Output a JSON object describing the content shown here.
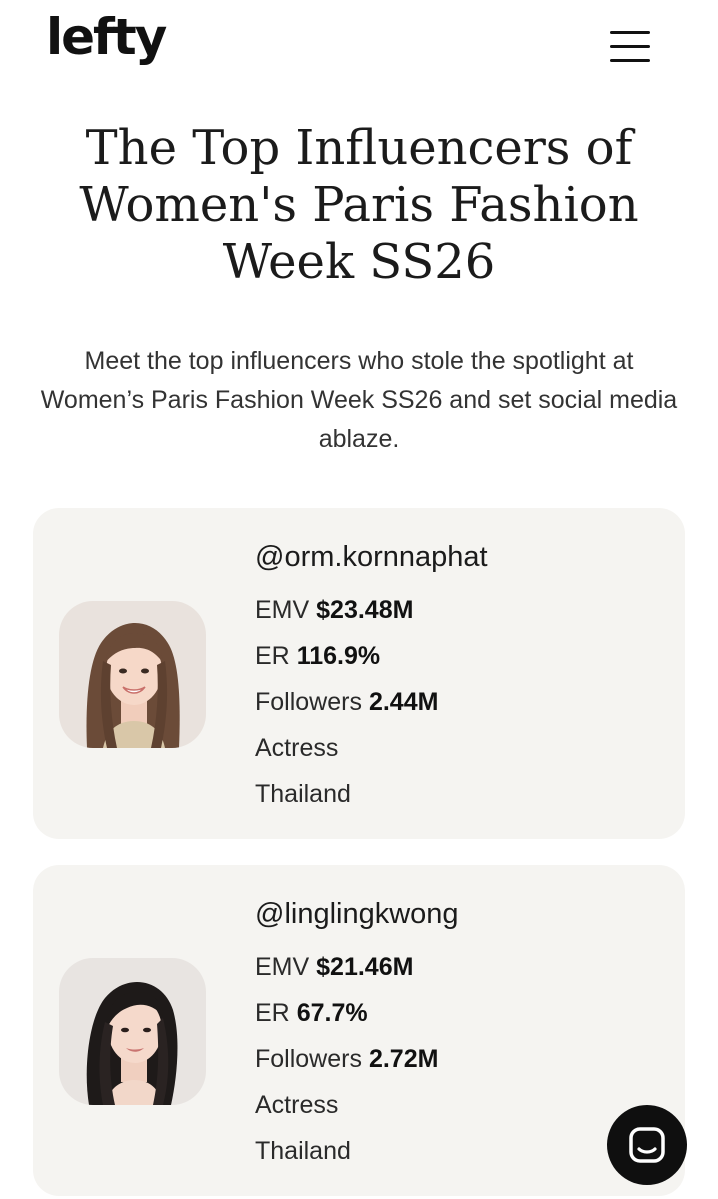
{
  "header": {
    "logo_text": "lefty",
    "menu_icon": "hamburger-menu-icon"
  },
  "hero": {
    "title": "The Top Influencers of Women's Paris Fashion Week SS26",
    "subtitle": "Meet the top influencers who stole the spotlight at Women’s Paris Fashion Week SS26 and set social media ablaze."
  },
  "influencers": [
    {
      "handle": "@orm.kornnaphat",
      "emv_label": "EMV",
      "emv_value": "$23.48M",
      "er_label": "ER",
      "er_value": "116.9%",
      "followers_label": "Followers",
      "followers_value": "2.44M",
      "category": "Actress",
      "country": "Thailand"
    },
    {
      "handle": "@linglingkwong",
      "emv_label": "EMV",
      "emv_value": "$21.46M",
      "er_label": "ER",
      "er_value": "67.7%",
      "followers_label": "Followers",
      "followers_value": "2.72M",
      "category": "Actress",
      "country": "Thailand"
    }
  ],
  "chat": {
    "icon": "chat-icon"
  },
  "colors": {
    "card_background": "#f5f4f1",
    "text": "#1c1c1c",
    "chat_button": "#0f0f0f"
  }
}
